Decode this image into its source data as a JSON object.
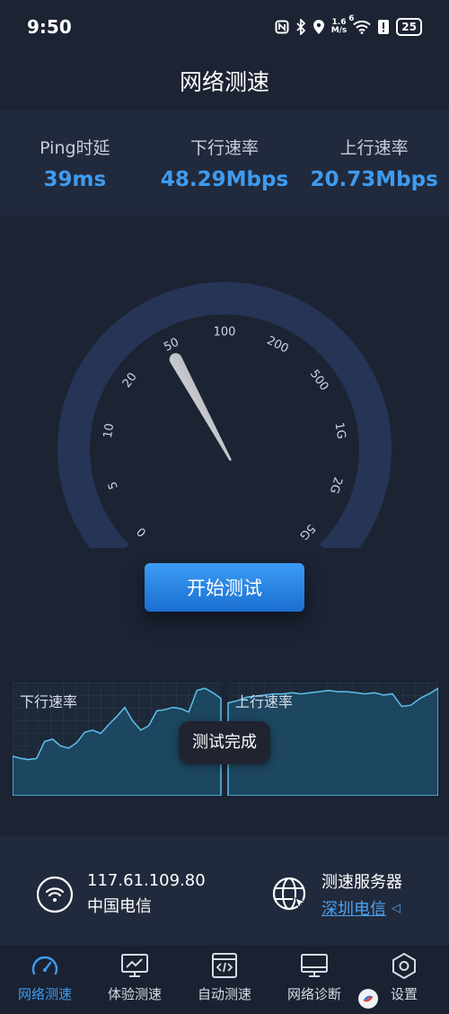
{
  "status_bar": {
    "time": "9:50",
    "net_speed_value": "1.6",
    "net_speed_unit": "M/s",
    "wifi_badge": "6",
    "battery": "25"
  },
  "header": {
    "title": "网络测速"
  },
  "stats": [
    {
      "label": "Ping时延",
      "value": "39ms"
    },
    {
      "label": "下行速率",
      "value": "48.29Mbps"
    },
    {
      "label": "上行速率",
      "value": "20.73Mbps"
    }
  ],
  "gauge": {
    "ticks": [
      "0",
      "5",
      "10",
      "20",
      "50",
      "100",
      "200",
      "500",
      "1G",
      "2G",
      "5G"
    ],
    "needle_value_mbps": 48.29
  },
  "start_button": {
    "label": "开始测试"
  },
  "charts": {
    "download_label": "下行速率",
    "upload_label": "上行速率",
    "download_series": [
      0.35,
      0.33,
      0.32,
      0.33,
      0.48,
      0.5,
      0.44,
      0.42,
      0.47,
      0.56,
      0.58,
      0.55,
      0.63,
      0.7,
      0.78,
      0.66,
      0.58,
      0.62,
      0.75,
      0.76,
      0.78,
      0.77,
      0.74,
      0.93,
      0.95,
      0.91,
      0.86
    ],
    "upload_series": [
      0.82,
      0.84,
      0.87,
      0.88,
      0.89,
      0.9,
      0.9,
      0.91,
      0.9,
      0.91,
      0.92,
      0.93,
      0.92,
      0.92,
      0.91,
      0.9,
      0.91,
      0.89,
      0.9,
      0.79,
      0.8,
      0.86,
      0.9,
      0.95
    ]
  },
  "toast": {
    "text": "测试完成"
  },
  "network_info": {
    "ip": "117.61.109.80",
    "isp": "中国电信",
    "server_title": "测速服务器",
    "server_name": "深圳电信"
  },
  "tabs": [
    {
      "label": "网络测速",
      "icon": "speedometer-icon",
      "active": true
    },
    {
      "label": "体验测速",
      "icon": "monitor-chart-icon",
      "active": false
    },
    {
      "label": "自动测速",
      "icon": "code-window-icon",
      "active": false
    },
    {
      "label": "网络诊断",
      "icon": "monitor-icon",
      "active": false
    },
    {
      "label": "设置",
      "icon": "hexagon-settings-icon",
      "active": false
    }
  ],
  "colors": {
    "accent": "#3e9bf0",
    "background": "#1c2333",
    "panel": "#212a3c",
    "gauge_arc": "#263556"
  }
}
